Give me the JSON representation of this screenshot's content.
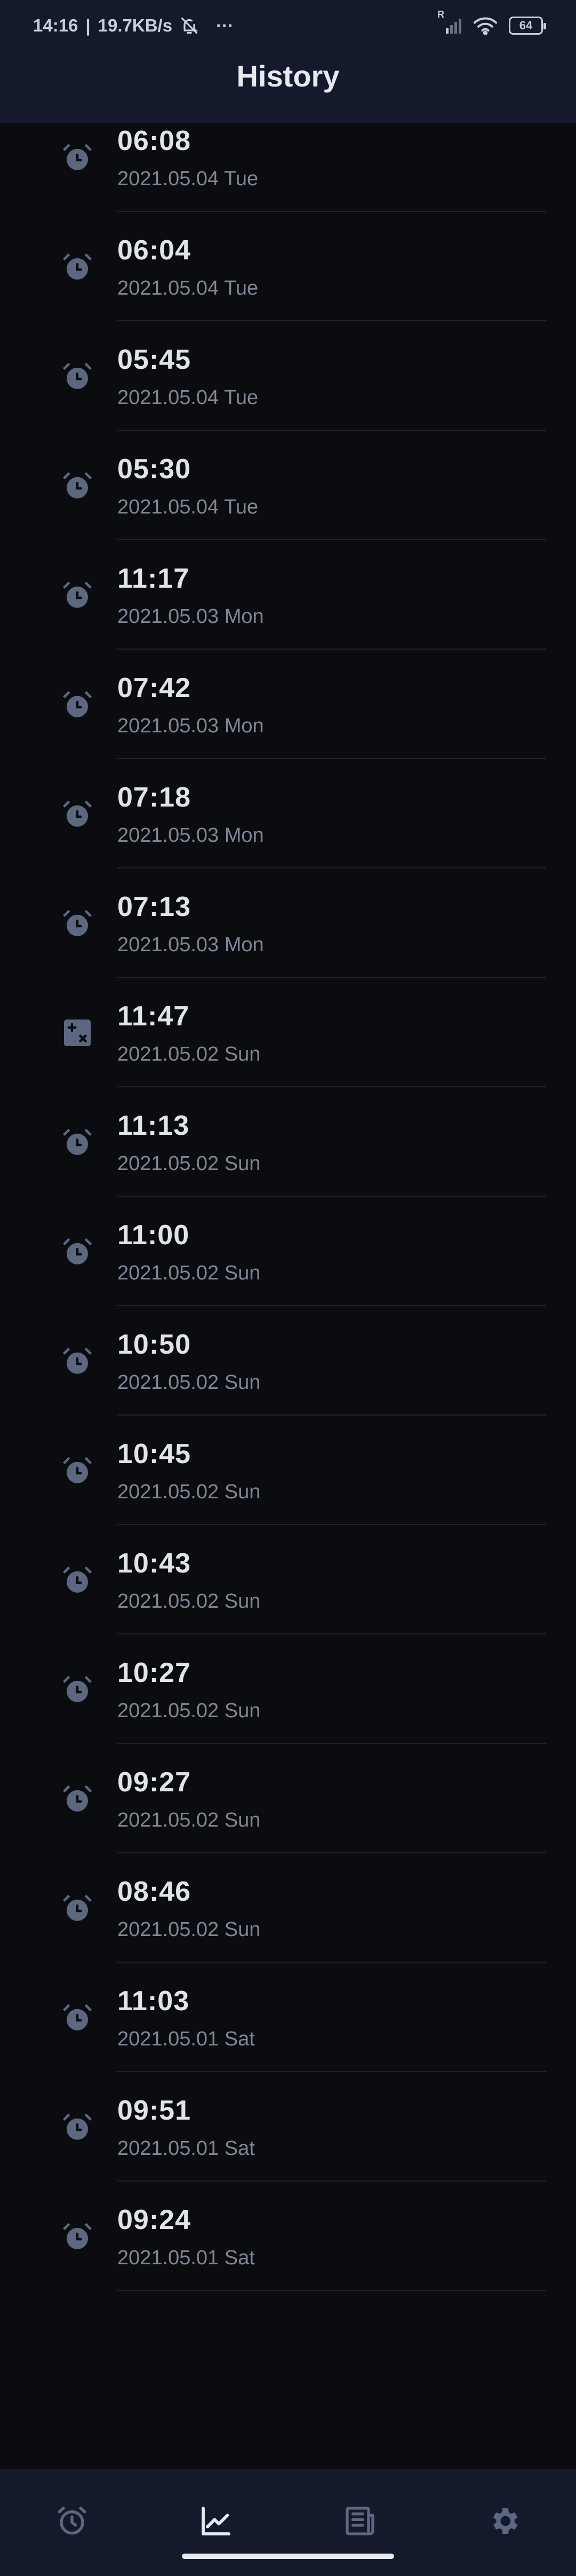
{
  "status_bar": {
    "time": "14:16",
    "separator": "|",
    "network_speed": "19.7KB/s",
    "more": "···",
    "roaming": "R",
    "battery": "64",
    "icons": [
      "mute-icon",
      "signal-icon",
      "wifi-icon",
      "battery-icon"
    ]
  },
  "header": {
    "title": "History"
  },
  "history": [
    {
      "time": "06:08",
      "date": "2021.05.04 Tue",
      "icon": "alarm-clock-icon"
    },
    {
      "time": "06:04",
      "date": "2021.05.04 Tue",
      "icon": "alarm-clock-icon"
    },
    {
      "time": "05:45",
      "date": "2021.05.04 Tue",
      "icon": "alarm-clock-icon"
    },
    {
      "time": "05:30",
      "date": "2021.05.04 Tue",
      "icon": "alarm-clock-icon"
    },
    {
      "time": "11:17",
      "date": "2021.05.03 Mon",
      "icon": "alarm-clock-icon"
    },
    {
      "time": "07:42",
      "date": "2021.05.03 Mon",
      "icon": "alarm-clock-icon"
    },
    {
      "time": "07:18",
      "date": "2021.05.03 Mon",
      "icon": "alarm-clock-icon"
    },
    {
      "time": "07:13",
      "date": "2021.05.03 Mon",
      "icon": "alarm-clock-icon"
    },
    {
      "time": "11:47",
      "date": "2021.05.02 Sun",
      "icon": "math-calculator-icon"
    },
    {
      "time": "11:13",
      "date": "2021.05.02 Sun",
      "icon": "alarm-clock-icon"
    },
    {
      "time": "11:00",
      "date": "2021.05.02 Sun",
      "icon": "alarm-clock-icon"
    },
    {
      "time": "10:50",
      "date": "2021.05.02 Sun",
      "icon": "alarm-clock-icon"
    },
    {
      "time": "10:45",
      "date": "2021.05.02 Sun",
      "icon": "alarm-clock-icon"
    },
    {
      "time": "10:43",
      "date": "2021.05.02 Sun",
      "icon": "alarm-clock-icon"
    },
    {
      "time": "10:27",
      "date": "2021.05.02 Sun",
      "icon": "alarm-clock-icon"
    },
    {
      "time": "09:27",
      "date": "2021.05.02 Sun",
      "icon": "alarm-clock-icon"
    },
    {
      "time": "08:46",
      "date": "2021.05.02 Sun",
      "icon": "alarm-clock-icon"
    },
    {
      "time": "11:03",
      "date": "2021.05.01 Sat",
      "icon": "alarm-clock-icon"
    },
    {
      "time": "09:51",
      "date": "2021.05.01 Sat",
      "icon": "alarm-clock-icon"
    },
    {
      "time": "09:24",
      "date": "2021.05.01 Sat",
      "icon": "alarm-clock-icon"
    }
  ],
  "bottom_nav": {
    "items": [
      {
        "name": "alarm",
        "icon": "alarm-clock-icon",
        "active": false
      },
      {
        "name": "history",
        "icon": "trend-chart-icon",
        "active": true
      },
      {
        "name": "news",
        "icon": "newspaper-icon",
        "active": false
      },
      {
        "name": "settings",
        "icon": "gear-icon",
        "active": false
      }
    ]
  },
  "colors": {
    "background": "#0b0c10",
    "bar": "#141a2b",
    "icon": "#5d6880",
    "time_text": "#dfe3ea",
    "date_text": "#7f8796",
    "active_nav": "#e6e9ef"
  }
}
